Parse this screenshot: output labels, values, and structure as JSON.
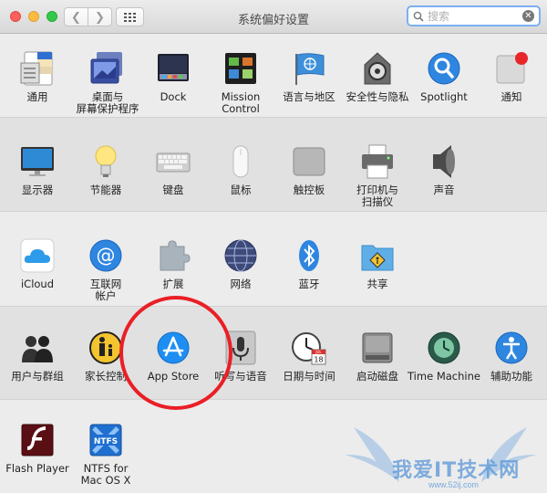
{
  "window": {
    "title": "系统偏好设置"
  },
  "search": {
    "placeholder": "搜索",
    "value": ""
  },
  "panes": [
    {
      "label": "通用",
      "icon": "general-icon"
    },
    {
      "label": "桌面与\n屏幕保护程序",
      "icon": "desktop-screensaver-icon"
    },
    {
      "label": "Dock",
      "icon": "dock-icon"
    },
    {
      "label": "Mission\nControl",
      "icon": "mission-control-icon"
    },
    {
      "label": "语言与地区",
      "icon": "language-region-icon"
    },
    {
      "label": "安全性与隐私",
      "icon": "security-privacy-icon"
    },
    {
      "label": "Spotlight",
      "icon": "spotlight-icon"
    },
    {
      "label": "通知",
      "icon": "notifications-icon"
    },
    {
      "label": "显示器",
      "icon": "displays-icon"
    },
    {
      "label": "节能器",
      "icon": "energy-saver-icon"
    },
    {
      "label": "键盘",
      "icon": "keyboard-icon"
    },
    {
      "label": "鼠标",
      "icon": "mouse-icon"
    },
    {
      "label": "触控板",
      "icon": "trackpad-icon"
    },
    {
      "label": "打印机与\n扫描仪",
      "icon": "printers-scanners-icon"
    },
    {
      "label": "声音",
      "icon": "sound-icon"
    },
    {
      "label": "iCloud",
      "icon": "icloud-icon"
    },
    {
      "label": "互联网\n帐户",
      "icon": "internet-accounts-icon"
    },
    {
      "label": "扩展",
      "icon": "extensions-icon"
    },
    {
      "label": "网络",
      "icon": "network-icon"
    },
    {
      "label": "蓝牙",
      "icon": "bluetooth-icon"
    },
    {
      "label": "共享",
      "icon": "sharing-icon"
    },
    {
      "label": "用户与群组",
      "icon": "users-groups-icon"
    },
    {
      "label": "家长控制",
      "icon": "parental-controls-icon"
    },
    {
      "label": "App Store",
      "icon": "app-store-icon"
    },
    {
      "label": "听写与语音",
      "icon": "dictation-speech-icon"
    },
    {
      "label": "日期与时间",
      "icon": "date-time-icon"
    },
    {
      "label": "启动磁盘",
      "icon": "startup-disk-icon"
    },
    {
      "label": "Time Machine",
      "icon": "time-machine-icon"
    },
    {
      "label": "辅助功能",
      "icon": "accessibility-icon"
    },
    {
      "label": "Flash Player",
      "icon": "flash-player-icon"
    },
    {
      "label": "NTFS for\nMac OS X",
      "icon": "ntfs-icon"
    }
  ],
  "icon_text": {
    "ntfs": "NTFS",
    "calendar_month": "JUL",
    "calendar_day": "18"
  },
  "watermark": {
    "brand": "我爱IT技术网",
    "url": "www.52ij.com"
  },
  "colors": {
    "annotation": "#ea1f26",
    "accent": "#1e8ef3"
  }
}
